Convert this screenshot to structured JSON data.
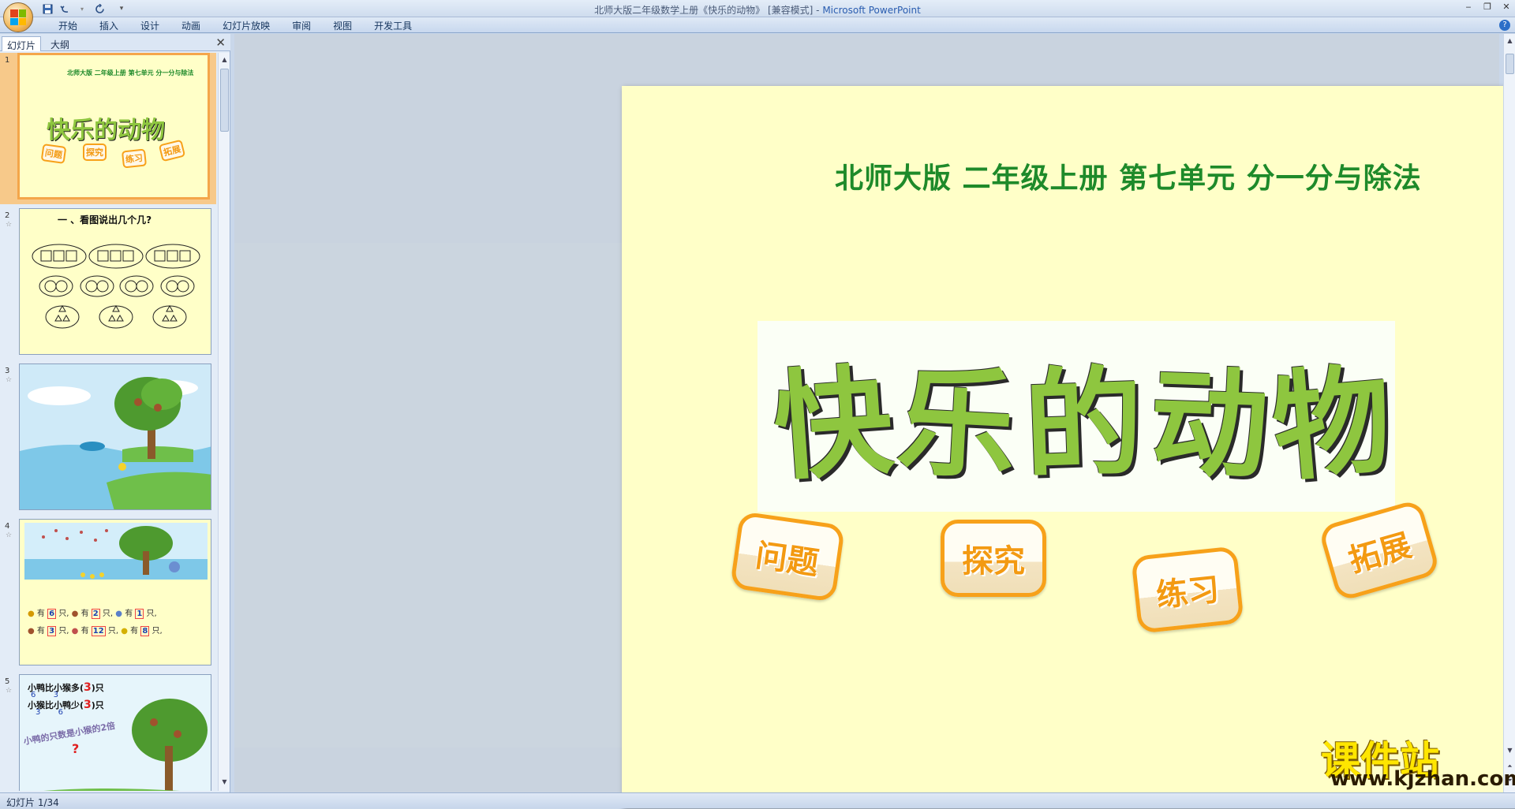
{
  "window": {
    "title": "北师大版二年级数学上册《快乐的动物》 [兼容模式] - ",
    "app_name": "Microsoft PowerPoint"
  },
  "quick_access": {
    "save_icon": "save-icon",
    "undo_icon": "undo-icon",
    "redo_icon": "redo-icon",
    "customize_icon": "dropdown-icon"
  },
  "ribbon": {
    "tabs": [
      "开始",
      "插入",
      "设计",
      "动画",
      "幻灯片放映",
      "审阅",
      "视图",
      "开发工具"
    ]
  },
  "panel": {
    "tab_slides": "幻灯片",
    "tab_outline": "大纲",
    "close": "✕"
  },
  "thumbnails": [
    {
      "num": "1",
      "subtitle": "北师大版  二年级上册  第七单元  分一分与除法",
      "title": "快乐的动物",
      "badges": [
        "问题",
        "探究",
        "练习",
        "拓展"
      ]
    },
    {
      "num": "2",
      "star": "☆",
      "heading": "一 、看图说出几个几?"
    },
    {
      "num": "3",
      "star": "☆"
    },
    {
      "num": "4",
      "star": "☆",
      "row1": [
        "有",
        "6",
        "只,",
        "有",
        "2",
        "只,",
        "有",
        "1",
        "只,"
      ],
      "row2": [
        "有",
        "3",
        "只,",
        "有",
        "12",
        "只,",
        "有",
        "8",
        "只,"
      ]
    },
    {
      "num": "5",
      "star": "☆",
      "line1": "小鸭比小猴多(",
      "n1": "3",
      "line1b": ")只",
      "frac1": [
        "6",
        "3"
      ],
      "line2": "小猴比小鸭少(",
      "n2": "3",
      "line2b": ")只",
      "frac2": [
        "3",
        "6"
      ],
      "slant": "小鸭的只数是小猴的2倍",
      "q": "?"
    }
  ],
  "slide": {
    "subtitle": "北师大版  二年级上册  第七单元  分一分与除法",
    "title_chars": [
      "快",
      "乐",
      "的",
      "动",
      "物"
    ],
    "badges": [
      "问题",
      "探究",
      "练习",
      "拓展"
    ]
  },
  "watermark": {
    "name": "课件站",
    "url": "www.kjzhan.com"
  },
  "status": {
    "slide_info": "幻灯片 1/34"
  },
  "colors": {
    "slide_bg": "#ffffc8",
    "green_text": "#1e8a2a",
    "title_green": "#8ec63f",
    "badge_orange": "#f7a11a",
    "selection": "#f4a64a"
  }
}
